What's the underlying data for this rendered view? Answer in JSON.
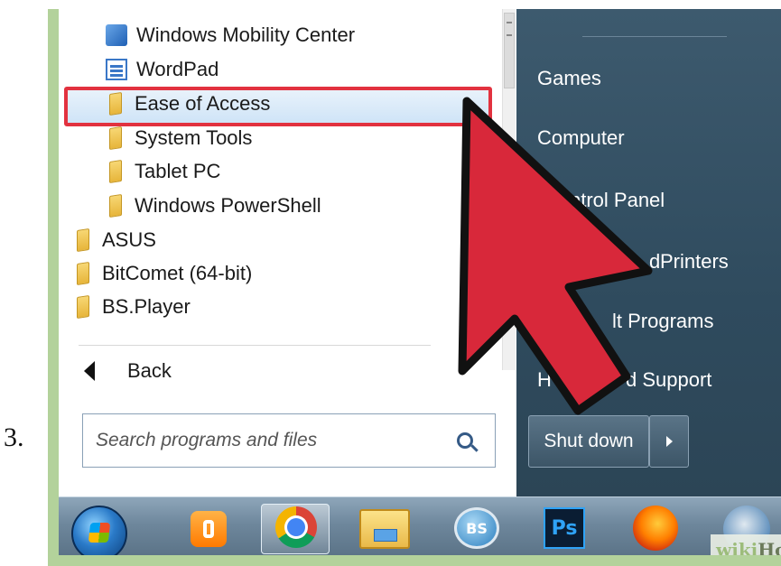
{
  "step_number": "3.",
  "programs": [
    {
      "label": "Windows Mobility Center",
      "icon": "mobility-center-icon"
    },
    {
      "label": "WordPad",
      "icon": "wordpad-icon"
    },
    {
      "label": "Ease of Access",
      "icon": "folder-icon",
      "highlighted": true
    },
    {
      "label": "System Tools",
      "icon": "folder-icon"
    },
    {
      "label": "Tablet PC",
      "icon": "folder-icon"
    },
    {
      "label": "Windows PowerShell",
      "icon": "folder-icon"
    },
    {
      "label": "ASUS",
      "icon": "folder-icon"
    },
    {
      "label": "BitComet (64-bit)",
      "icon": "folder-icon"
    },
    {
      "label": "BS.Player",
      "icon": "folder-icon"
    }
  ],
  "back_label": "Back",
  "search": {
    "placeholder": "Search programs and files"
  },
  "right_menu": {
    "games": "Games",
    "computer": "Computer",
    "control_panel": "ntrol Panel",
    "devices_printers_a": "d",
    "devices_printers_b": "Printers",
    "default_programs": "lt Programs",
    "help_a": "H",
    "help_b": "d Support"
  },
  "shutdown_label": "Shut down",
  "taskbar_apps": [
    "start-orb-icon",
    "media-player-icon",
    "chrome-icon",
    "file-explorer-icon",
    "bs-player-icon",
    "photoshop-icon",
    "firefox-icon",
    "thunderbird-icon"
  ],
  "bs_label": "BS",
  "ps_label": "Ps",
  "watermark": {
    "wiki": "wiki",
    "how": "How"
  },
  "colors": {
    "highlight_border": "#e2323f",
    "arrow_fill": "#d8283a",
    "frame": "#b3d29b"
  }
}
